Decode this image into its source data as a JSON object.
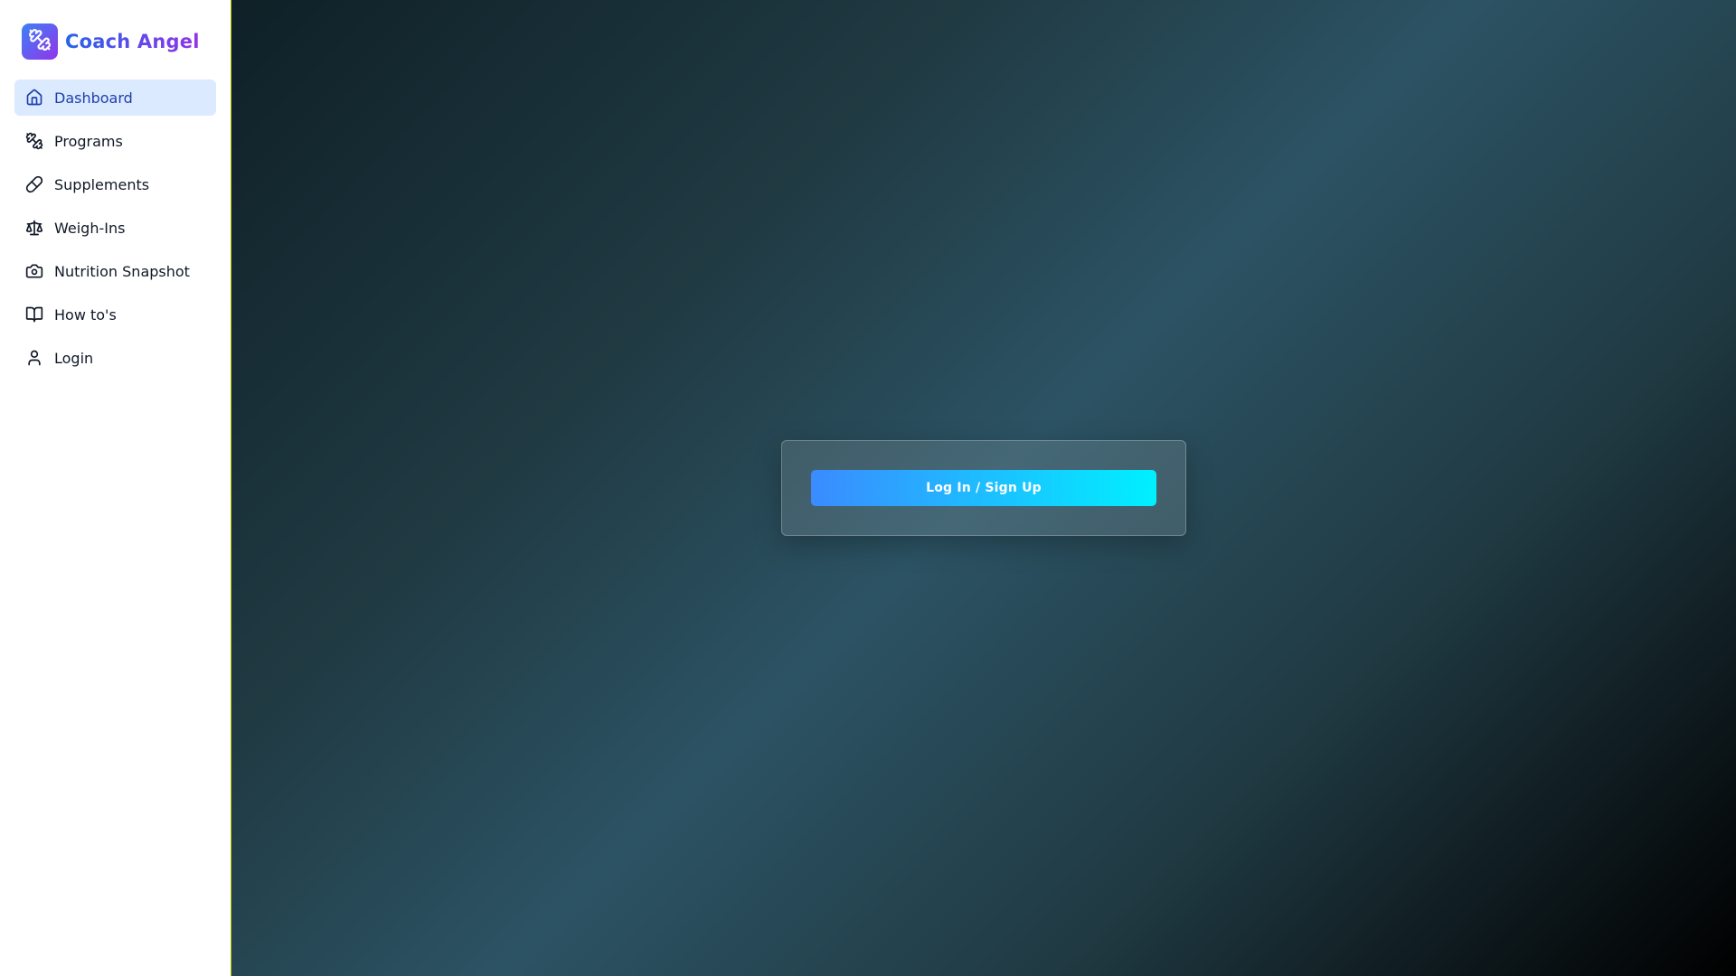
{
  "brand": {
    "name": "Coach Angel",
    "logo_icon": "dumbbell-icon",
    "gradient": [
      "#3b82f6",
      "#9333ea"
    ]
  },
  "sidebar": {
    "items": [
      {
        "label": "Dashboard",
        "icon": "home-icon",
        "active": true
      },
      {
        "label": "Programs",
        "icon": "dumbbell-icon",
        "active": false
      },
      {
        "label": "Supplements",
        "icon": "pill-icon",
        "active": false
      },
      {
        "label": "Weigh-Ins",
        "icon": "scale-icon",
        "active": false
      },
      {
        "label": "Nutrition Snapshot",
        "icon": "camera-icon",
        "active": false
      },
      {
        "label": "How to's",
        "icon": "book-icon",
        "active": false
      },
      {
        "label": "Login",
        "icon": "user-icon",
        "active": false
      }
    ],
    "active_bg": "#dbeafe",
    "active_color": "#1e40af"
  },
  "main": {
    "login_button_label": "Log In / Sign Up",
    "button_gradient": [
      "#3b8bff",
      "#00f0ff"
    ]
  }
}
